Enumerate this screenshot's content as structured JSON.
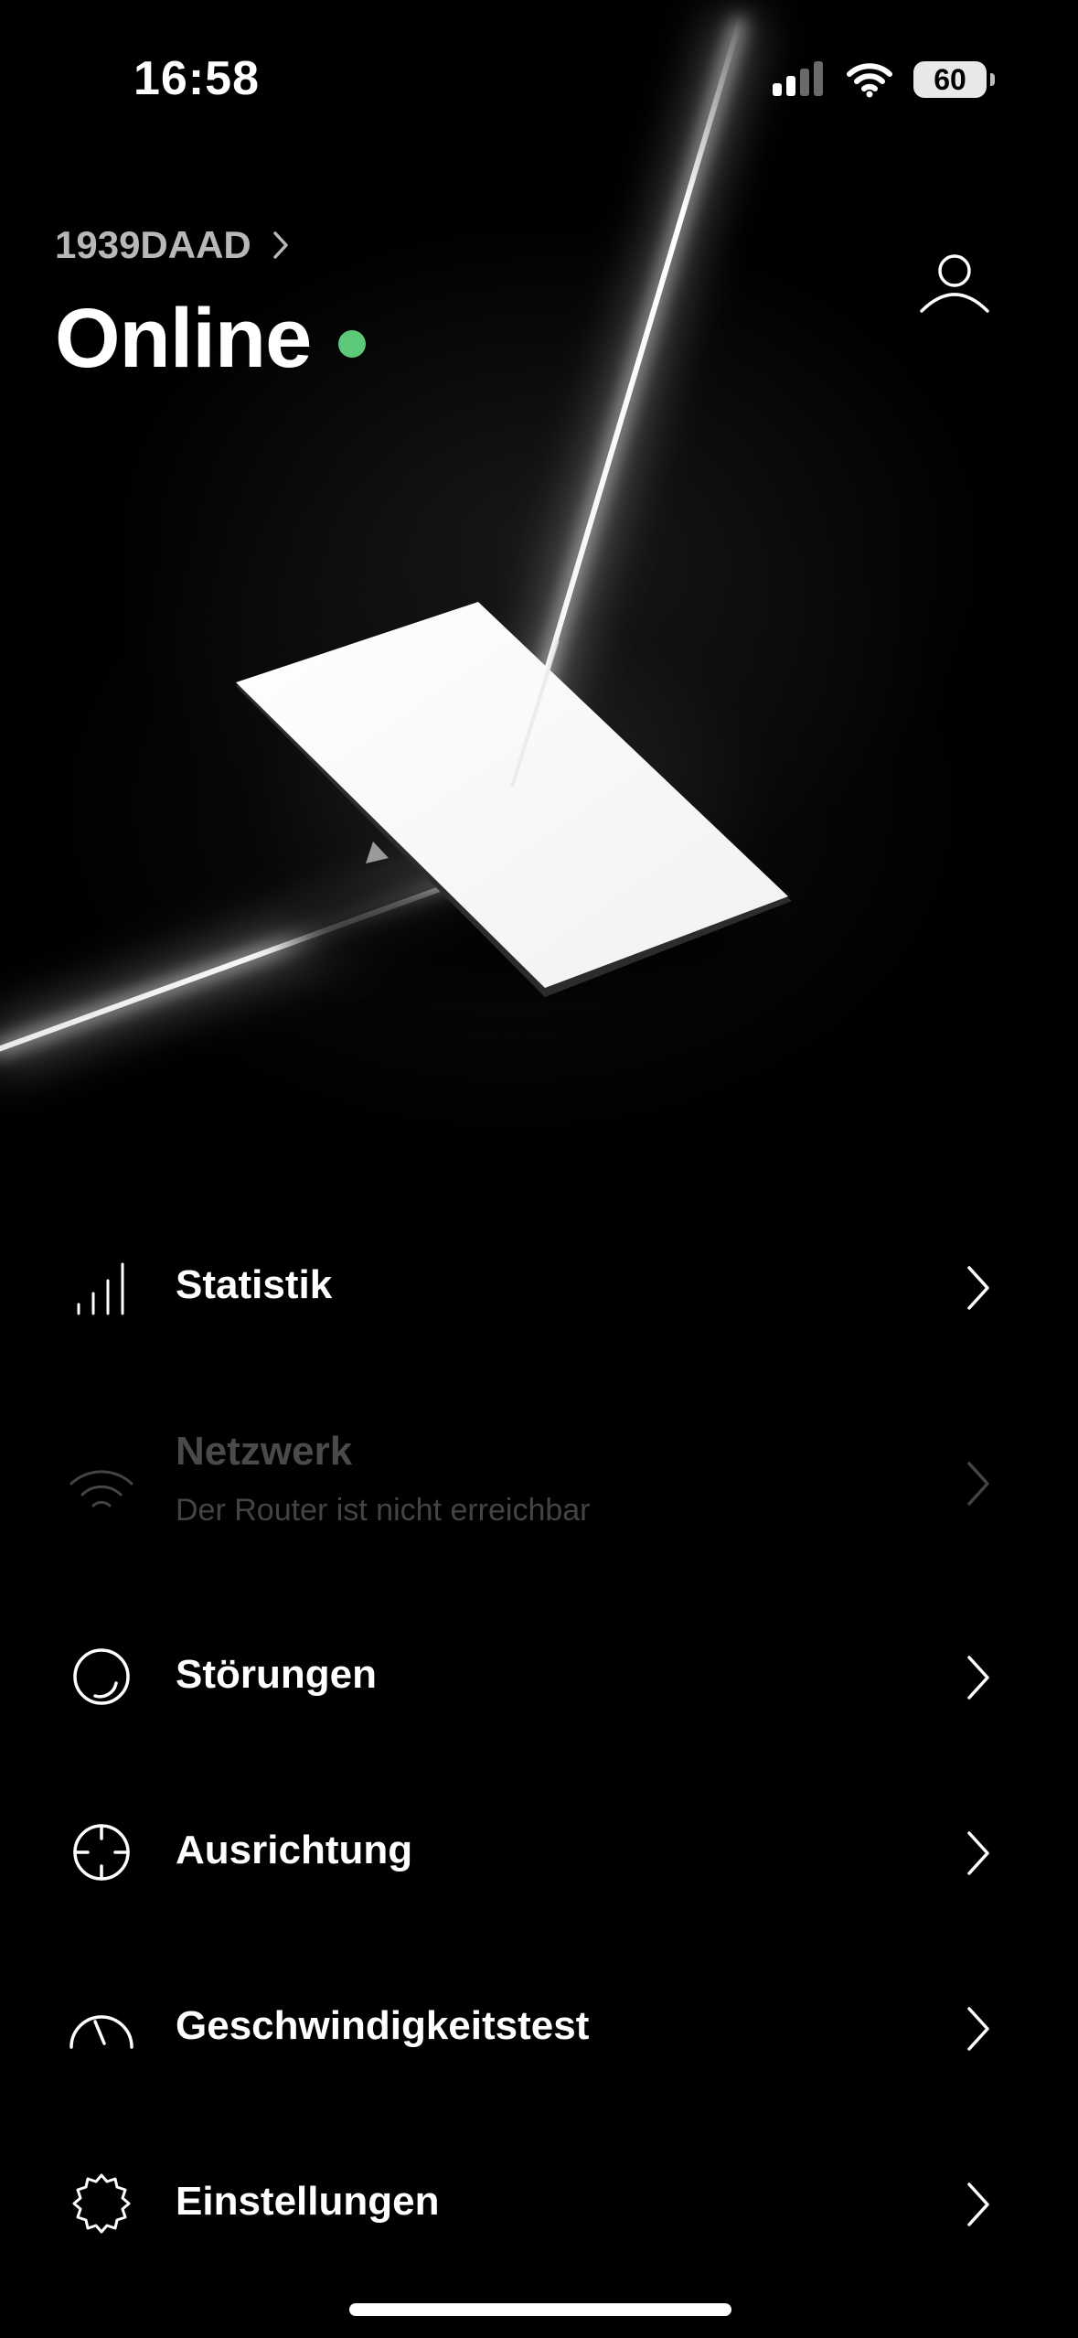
{
  "status_bar": {
    "time": "16:58",
    "battery": "60",
    "icons": [
      "cellular-signal-icon",
      "wifi-icon",
      "battery-icon"
    ]
  },
  "header": {
    "device_id": "1939DAAD",
    "status": "Online",
    "status_color": "#5cc878",
    "account_icon": "person-icon"
  },
  "menu": {
    "items": [
      {
        "label": "Statistik",
        "sublabel": "",
        "icon": "bar-chart-icon",
        "enabled": true
      },
      {
        "label": "Netzwerk",
        "sublabel": "Der Router ist nicht erreichbar",
        "icon": "wifi-icon",
        "enabled": false
      },
      {
        "label": "Störungen",
        "sublabel": "",
        "icon": "outage-circle-icon",
        "enabled": true
      },
      {
        "label": "Ausrichtung",
        "sublabel": "",
        "icon": "crosshair-icon",
        "enabled": true
      },
      {
        "label": "Geschwindigkeitstest",
        "sublabel": "",
        "icon": "speedometer-icon",
        "enabled": true
      },
      {
        "label": "Einstellungen",
        "sublabel": "",
        "icon": "gear-icon",
        "enabled": true
      }
    ]
  }
}
